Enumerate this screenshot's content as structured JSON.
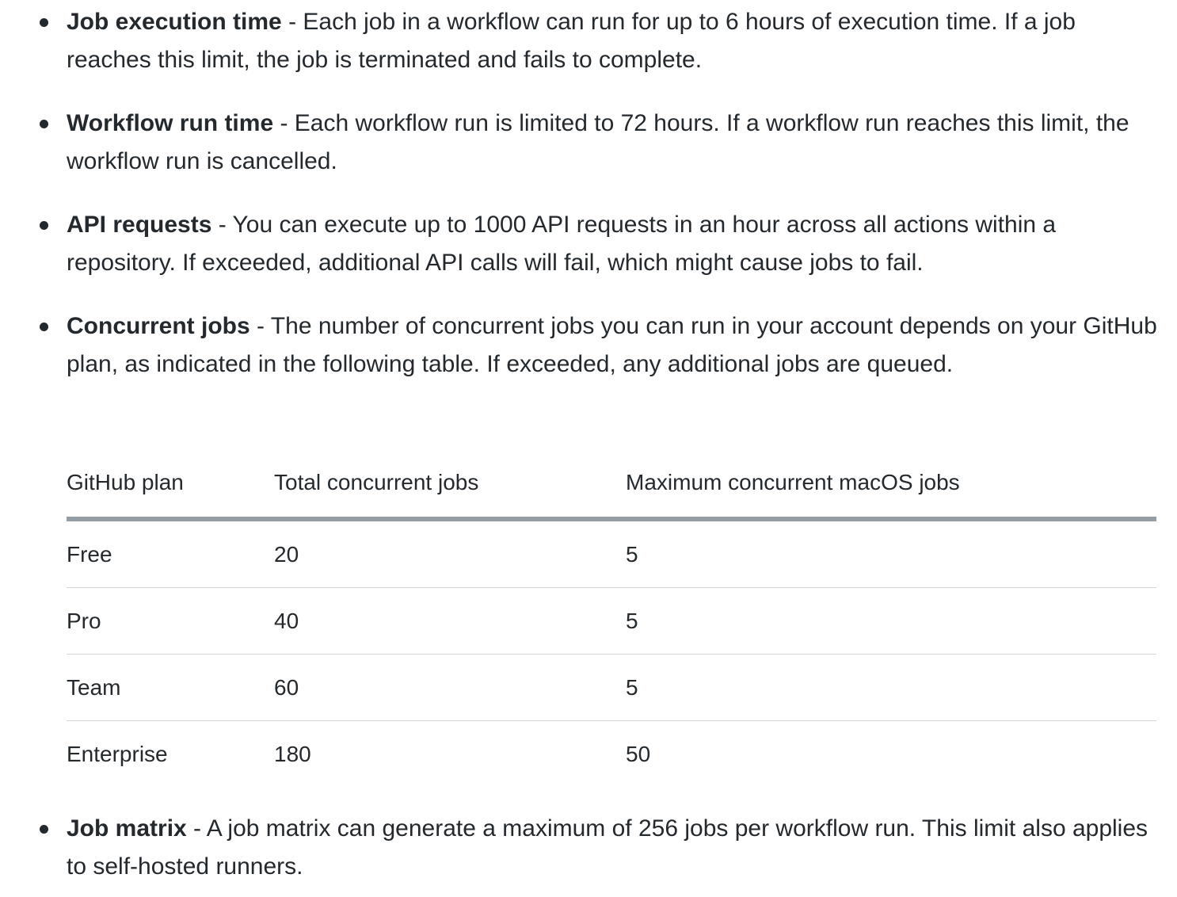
{
  "limits": [
    {
      "term": "Job execution time",
      "text": " - Each job in a workflow can run for up to 6 hours of execution time. If a job reaches this limit, the job is terminated and fails to complete."
    },
    {
      "term": "Workflow run time",
      "text": " - Each workflow run is limited to 72 hours. If a workflow run reaches this limit, the workflow run is cancelled."
    },
    {
      "term": "API requests",
      "text": " - You can execute up to 1000 API requests in an hour across all actions within a repository. If exceeded, additional API calls will fail, which might cause jobs to fail."
    },
    {
      "term": "Concurrent jobs",
      "text": " - The number of concurrent jobs you can run in your account depends on your GitHub plan, as indicated in the following table. If exceeded, any additional jobs are queued."
    },
    {
      "term": "Job matrix",
      "text": " - A job matrix can generate a maximum of 256 jobs per workflow run. This limit also applies to self-hosted runners."
    }
  ],
  "table": {
    "headers": [
      "GitHub plan",
      "Total concurrent jobs",
      "Maximum concurrent macOS jobs"
    ],
    "rows": [
      [
        "Free",
        "20",
        "5"
      ],
      [
        "Pro",
        "40",
        "5"
      ],
      [
        "Team",
        "60",
        "5"
      ],
      [
        "Enterprise",
        "180",
        "50"
      ]
    ]
  }
}
